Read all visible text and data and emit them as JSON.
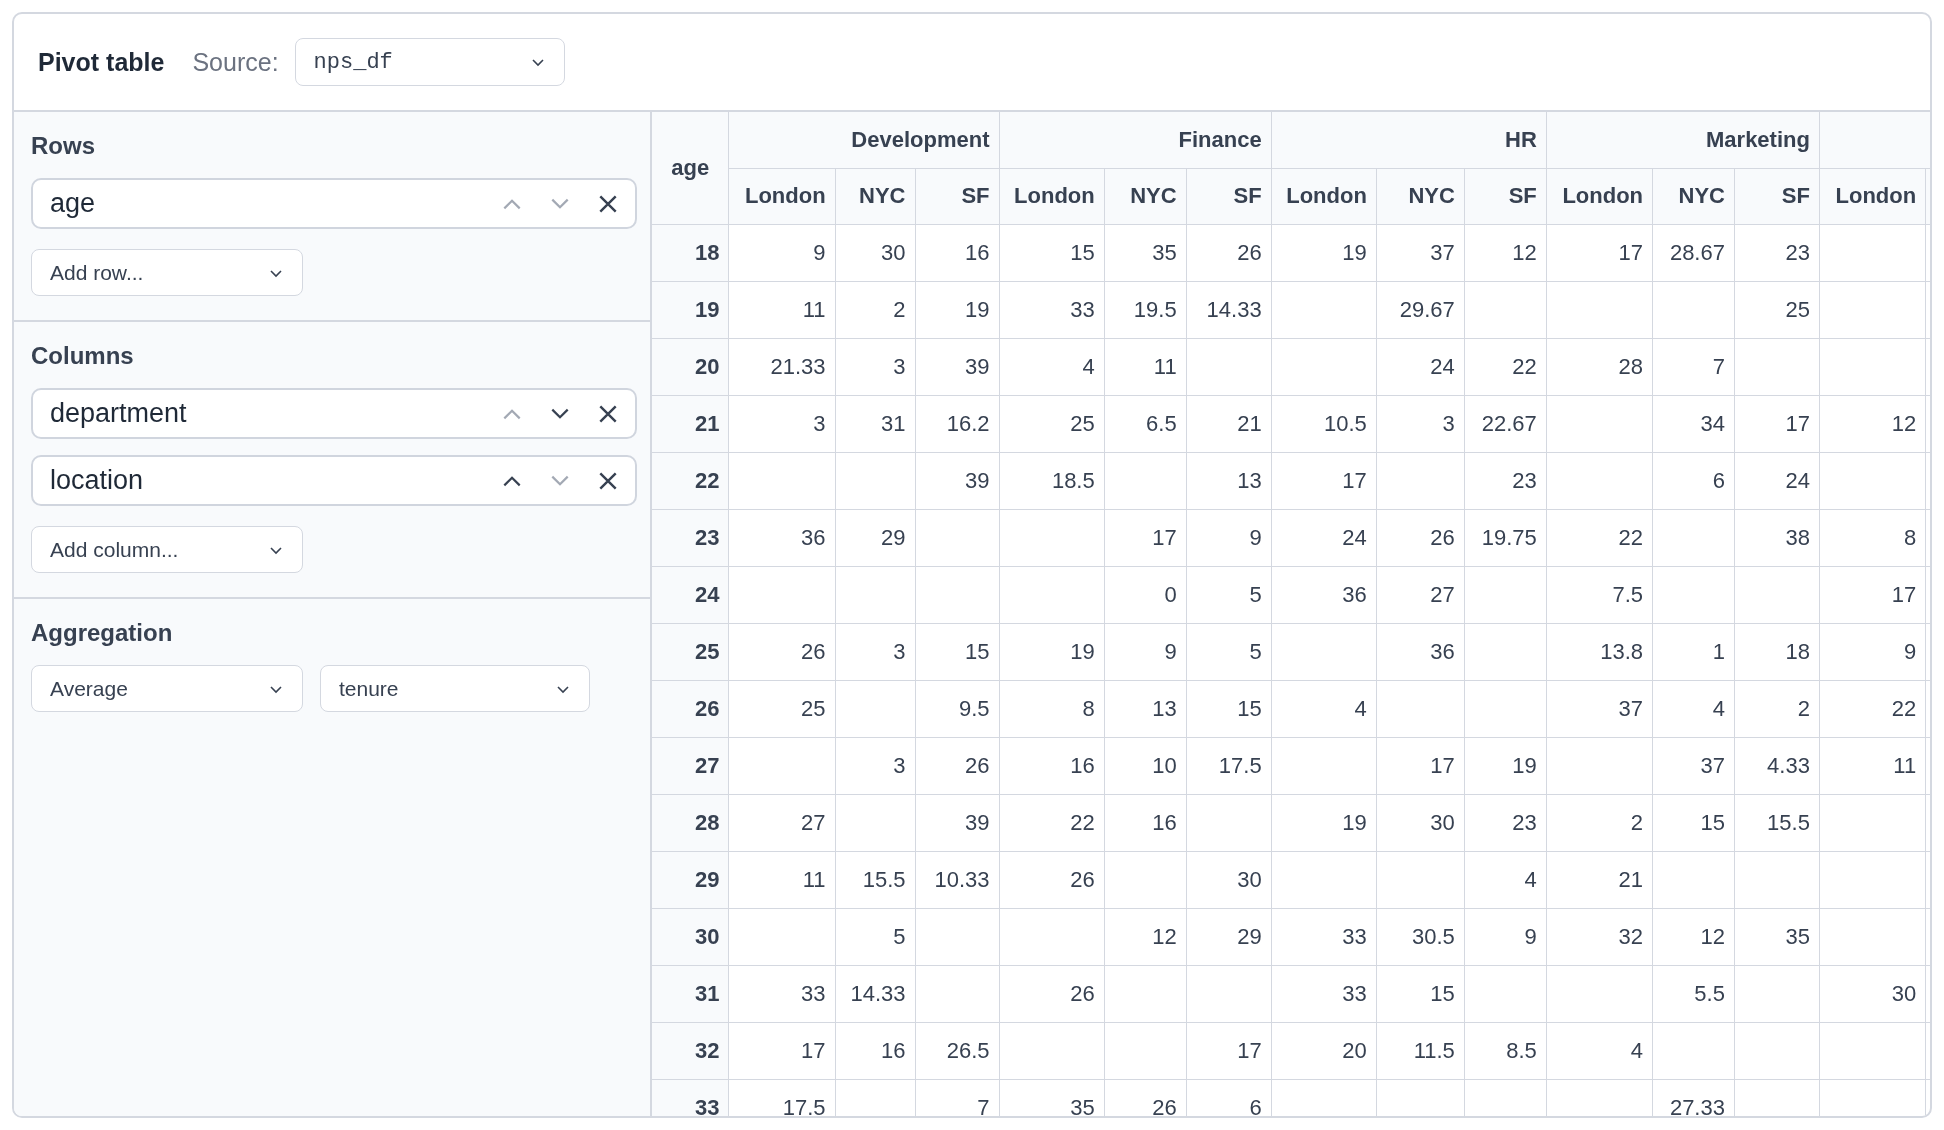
{
  "header": {
    "title": "Pivot table",
    "source_label": "Source:",
    "source_value": "nps_df"
  },
  "rows_section": {
    "title": "Rows",
    "fields": [
      {
        "label": "age",
        "up_disabled": true,
        "down_disabled": true
      }
    ],
    "add_placeholder": "Add row..."
  },
  "columns_section": {
    "title": "Columns",
    "fields": [
      {
        "label": "department",
        "up_disabled": true,
        "down_disabled": false
      },
      {
        "label": "location",
        "up_disabled": false,
        "down_disabled": true
      }
    ],
    "add_placeholder": "Add column..."
  },
  "aggregation": {
    "title": "Aggregation",
    "function": "Average",
    "field": "tenure"
  },
  "table": {
    "row_header": "age",
    "groups": [
      {
        "name": "Development",
        "columns": [
          "London",
          "NYC",
          "SF"
        ]
      },
      {
        "name": "Finance",
        "columns": [
          "London",
          "NYC",
          "SF"
        ]
      },
      {
        "name": "HR",
        "columns": [
          "London",
          "NYC",
          "SF"
        ]
      },
      {
        "name": "Marketing",
        "columns": [
          "London",
          "NYC",
          "SF"
        ]
      },
      {
        "columns": [
          "London"
        ]
      }
    ],
    "rows": [
      {
        "label": "18",
        "cells": {
          "col_1": "9",
          "col_2": "30",
          "col_3": "16",
          "col_4": "15",
          "col_5": "35",
          "col_6": "26",
          "col_7": "19",
          "col_8": "37",
          "col_9": "12",
          "col_10": "17",
          "col_11": "28.67",
          "col_12": "23"
        }
      },
      {
        "label": "19",
        "cells": {
          "col_1": "11",
          "col_2": "2",
          "col_3": "19",
          "col_4": "33",
          "col_5": "19.5",
          "col_6": "14.33",
          "col_8": "29.67",
          "col_12": "25"
        }
      },
      {
        "label": "20",
        "cells": {
          "col_1": "21.33",
          "col_2": "3",
          "col_3": "39",
          "col_4": "4",
          "col_5": "11",
          "col_8": "24",
          "col_9": "22",
          "col_10": "28",
          "col_11": "7"
        }
      },
      {
        "label": "21",
        "cells": {
          "col_1": "3",
          "col_2": "31",
          "col_3": "16.2",
          "col_4": "25",
          "col_5": "6.5",
          "col_6": "21",
          "col_7": "10.5",
          "col_8": "3",
          "col_9": "22.67",
          "col_11": "34",
          "col_12": "17",
          "col_13": "12"
        }
      },
      {
        "label": "22",
        "cells": {
          "col_3": "39",
          "col_4": "18.5",
          "col_6": "13",
          "col_7": "17",
          "col_9": "23",
          "col_11": "6",
          "col_12": "24"
        }
      },
      {
        "label": "23",
        "cells": {
          "col_1": "36",
          "col_2": "29",
          "col_5": "17",
          "col_6": "9",
          "col_7": "24",
          "col_8": "26",
          "col_9": "19.75",
          "col_10": "22",
          "col_12": "38",
          "col_13": "8"
        }
      },
      {
        "label": "24",
        "cells": {
          "col_5": "0",
          "col_6": "5",
          "col_7": "36",
          "col_8": "27",
          "col_10": "7.5",
          "col_13": "17"
        }
      },
      {
        "label": "25",
        "cells": {
          "col_1": "26",
          "col_2": "3",
          "col_3": "15",
          "col_4": "19",
          "col_5": "9",
          "col_6": "5",
          "col_8": "36",
          "col_10": "13.8",
          "col_11": "1",
          "col_12": "18",
          "col_13": "9"
        }
      },
      {
        "label": "26",
        "cells": {
          "col_1": "25",
          "col_3": "9.5",
          "col_4": "8",
          "col_5": "13",
          "col_6": "15",
          "col_7": "4",
          "col_10": "37",
          "col_11": "4",
          "col_12": "2",
          "col_13": "22"
        }
      },
      {
        "label": "27",
        "cells": {
          "col_2": "3",
          "col_3": "26",
          "col_4": "16",
          "col_5": "10",
          "col_6": "17.5",
          "col_8": "17",
          "col_9": "19",
          "col_11": "37",
          "col_12": "4.33",
          "col_13": "11"
        }
      },
      {
        "label": "28",
        "cells": {
          "col_1": "27",
          "col_3": "39",
          "col_4": "22",
          "col_5": "16",
          "col_7": "19",
          "col_8": "30",
          "col_9": "23",
          "col_10": "2",
          "col_11": "15",
          "col_12": "15.5"
        }
      },
      {
        "label": "29",
        "cells": {
          "col_1": "11",
          "col_2": "15.5",
          "col_3": "10.33",
          "col_4": "26",
          "col_6": "30",
          "col_9": "4",
          "col_10": "21"
        }
      },
      {
        "label": "30",
        "cells": {
          "col_2": "5",
          "col_5": "12",
          "col_6": "29",
          "col_7": "33",
          "col_8": "30.5",
          "col_9": "9",
          "col_10": "32",
          "col_11": "12",
          "col_12": "35"
        }
      },
      {
        "label": "31",
        "cells": {
          "col_1": "33",
          "col_2": "14.33",
          "col_4": "26",
          "col_7": "33",
          "col_8": "15",
          "col_11": "5.5",
          "col_13": "30"
        }
      },
      {
        "label": "32",
        "cells": {
          "col_1": "17",
          "col_2": "16",
          "col_3": "26.5",
          "col_6": "17",
          "col_7": "20",
          "col_8": "11.5",
          "col_9": "8.5",
          "col_10": "4"
        }
      },
      {
        "label": "33",
        "cells": {
          "col_1": "17.5",
          "col_3": "7",
          "col_4": "35",
          "col_5": "26",
          "col_6": "6",
          "col_11": "27.33"
        }
      }
    ]
  }
}
